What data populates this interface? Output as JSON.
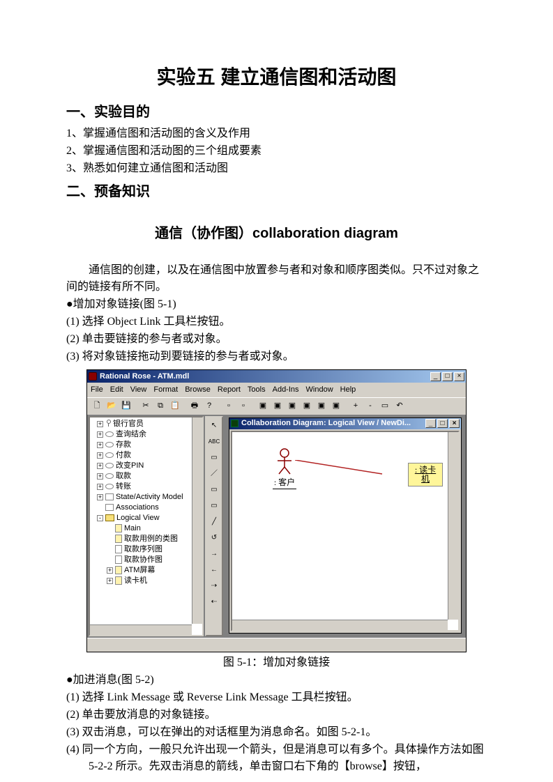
{
  "title": "实验五 建立通信图和活动图",
  "section1_heading": "一、实验目的",
  "objectives": [
    "1、掌握通信图和活动图的含义及作用",
    "2、掌握通信图和活动图的三个组成要素",
    "3、熟悉如何建立通信图和活动图"
  ],
  "section2_heading": "二、预备知识",
  "subheading": "通信（协作图）collaboration diagram",
  "intro_para": "通信图的创建，以及在通信图中放置参与者和对象和顺序图类似。只不过对象之间的链接有所不同。",
  "bullet1": "●增加对象链接(图 5-1)",
  "steps_a": [
    "(1) 选择 Object Link 工具栏按钮。",
    "(2) 单击要链接的参与者或对象。",
    "(3) 将对象链接拖动到要链接的参与者或对象。"
  ],
  "caption1": "图 5-1：增加对象链接",
  "bullet2": "●加进消息(图 5-2)",
  "steps_b": [
    "(1) 选择 Link Message 或 Reverse Link Message 工具栏按钮。",
    "(2) 单击要放消息的对象链接。",
    "(3) 双击消息，可以在弹出的对话框里为消息命名。如图 5-2-1。",
    "(4) 同一个方向，一般只允许出现一个箭头，但是消息可以有多个。具体操作方法如图 5-2-2 所示。先双击消息的箭线，单击窗口右下角的【browse】按钮，"
  ],
  "app": {
    "title": "Rational Rose - ATM.mdl",
    "menus": [
      "File",
      "Edit",
      "View",
      "Format",
      "Browse",
      "Report",
      "Tools",
      "Add-Ins",
      "Window",
      "Help"
    ],
    "tree": [
      {
        "exp": "+",
        "icon": "actor",
        "label": "银行官员"
      },
      {
        "exp": "+",
        "icon": "usecase",
        "label": "查询结余"
      },
      {
        "exp": "+",
        "icon": "usecase",
        "label": "存款"
      },
      {
        "exp": "+",
        "icon": "usecase",
        "label": "付款"
      },
      {
        "exp": "+",
        "icon": "usecase",
        "label": "改变PIN"
      },
      {
        "exp": "+",
        "icon": "usecase",
        "label": "取款"
      },
      {
        "exp": "+",
        "icon": "usecase",
        "label": "转账"
      },
      {
        "exp": "+",
        "icon": "hold",
        "label": "State/Activity Model"
      },
      {
        "exp": "",
        "icon": "hold",
        "label": "Associations"
      },
      {
        "exp": "-",
        "icon": "folder",
        "label": "Logical View"
      },
      {
        "exp": "",
        "icon": "fileY",
        "label": "Main",
        "indent": 1
      },
      {
        "exp": "",
        "icon": "fileY",
        "label": "取款用例的类图",
        "indent": 1
      },
      {
        "exp": "",
        "icon": "file",
        "label": "取款序列图",
        "indent": 1,
        "mark": "seq"
      },
      {
        "exp": "",
        "icon": "file",
        "label": "取款协作图",
        "indent": 1,
        "mark": "col"
      },
      {
        "exp": "+",
        "icon": "fileY",
        "label": "ATM屏幕",
        "indent": 1
      },
      {
        "exp": "+",
        "icon": "fileY",
        "label": "读卡机",
        "indent": 1
      }
    ],
    "subwin_title": "Collaboration Diagram: Logical View / NewDi...",
    "actor_label": ": 客户",
    "object_label": ": 读卡机"
  }
}
